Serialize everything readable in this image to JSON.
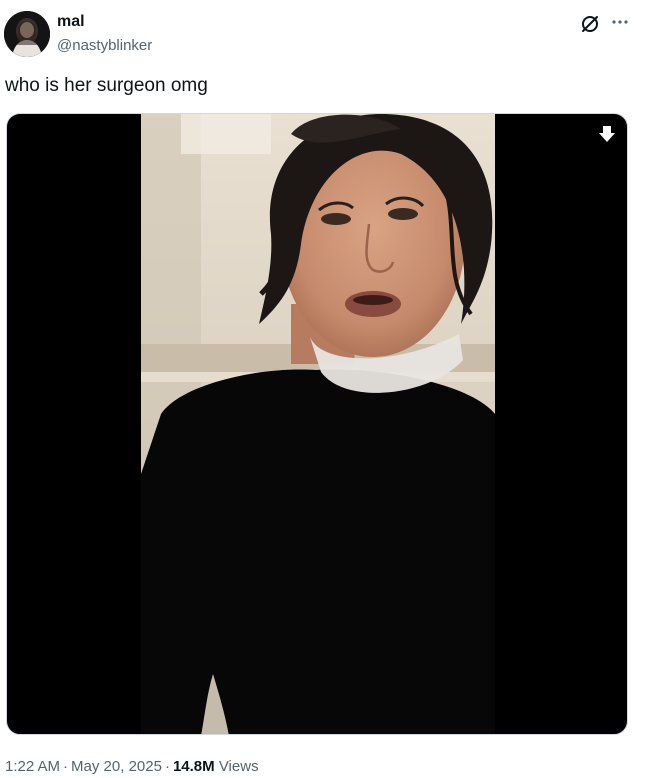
{
  "author": {
    "display_name": "mal",
    "handle": "@nastyblinker",
    "avatar_icon": "profile-photo"
  },
  "header_actions": {
    "grok_icon": "grok-slash-circle-icon",
    "more_icon": "more-dots-icon",
    "more_label": "···"
  },
  "tweet": {
    "text": "who is her surgeon omg"
  },
  "media": {
    "type": "video",
    "download_icon": "download-arrow-icon"
  },
  "meta": {
    "time": "1:22 AM",
    "separator": "·",
    "date": "May 20, 2025",
    "views_count": "14.8M",
    "views_label": "Views"
  },
  "colors": {
    "text_primary": "#0f1419",
    "text_secondary": "#536471",
    "media_border": "#cfd9de",
    "media_background": "#000000"
  }
}
